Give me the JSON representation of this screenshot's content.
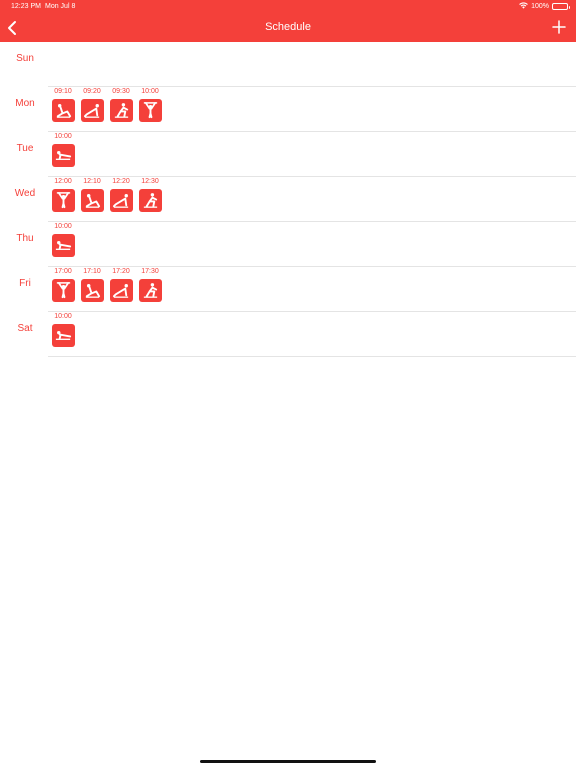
{
  "status_bar": {
    "time": "12:23 PM",
    "date": "Mon Jul 8",
    "battery": "100%"
  },
  "nav": {
    "title": "Schedule"
  },
  "colors": {
    "accent": "#f4403a",
    "separator": "#e4e4e4"
  },
  "days": [
    {
      "label": "Sun",
      "sessions": []
    },
    {
      "label": "Mon",
      "sessions": [
        {
          "time": "09:10",
          "icon": "crunch-icon"
        },
        {
          "time": "09:20",
          "icon": "pushup-icon"
        },
        {
          "time": "09:30",
          "icon": "squat-icon"
        },
        {
          "time": "10:00",
          "icon": "pullup-icon"
        }
      ]
    },
    {
      "label": "Tue",
      "sessions": [
        {
          "time": "10:00",
          "icon": "plank-icon"
        }
      ]
    },
    {
      "label": "Wed",
      "sessions": [
        {
          "time": "12:00",
          "icon": "pullup-icon"
        },
        {
          "time": "12:10",
          "icon": "crunch-icon"
        },
        {
          "time": "12:20",
          "icon": "pushup-icon"
        },
        {
          "time": "12:30",
          "icon": "squat-icon"
        }
      ]
    },
    {
      "label": "Thu",
      "sessions": [
        {
          "time": "10:00",
          "icon": "plank-icon"
        }
      ]
    },
    {
      "label": "Fri",
      "sessions": [
        {
          "time": "17:00",
          "icon": "pullup-icon"
        },
        {
          "time": "17:10",
          "icon": "crunch-icon"
        },
        {
          "time": "17:20",
          "icon": "pushup-icon"
        },
        {
          "time": "17:30",
          "icon": "squat-icon"
        }
      ]
    },
    {
      "label": "Sat",
      "sessions": [
        {
          "time": "10:00",
          "icon": "plank-icon"
        }
      ]
    }
  ]
}
